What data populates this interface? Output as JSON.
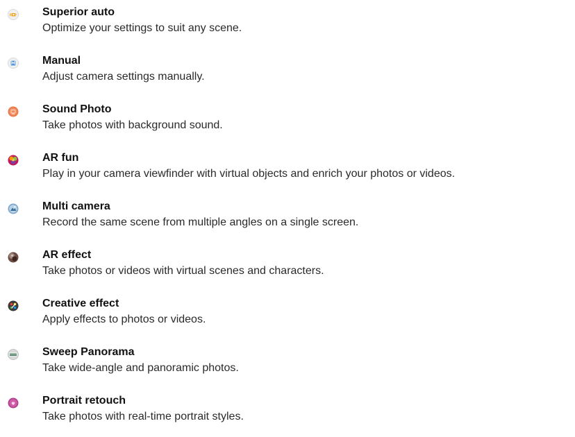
{
  "modes": [
    {
      "title": "Superior auto",
      "description": "Optimize your settings to suit any scene.",
      "icon": "superior-auto-icon"
    },
    {
      "title": "Manual",
      "description": "Adjust camera settings manually.",
      "icon": "manual-m-icon"
    },
    {
      "title": "Sound Photo",
      "description": "Take photos with background sound.",
      "icon": "sound-photo-icon"
    },
    {
      "title": "AR fun",
      "description": "Play in your camera viewfinder with virtual objects and enrich your photos or videos.",
      "icon": "ar-fun-icon"
    },
    {
      "title": "Multi camera",
      "description": "Record the same scene from multiple angles on a single screen.",
      "icon": "multi-camera-icon"
    },
    {
      "title": "AR effect",
      "description": "Take photos or videos with virtual scenes and characters.",
      "icon": "ar-effect-icon"
    },
    {
      "title": "Creative effect",
      "description": "Apply effects to photos or videos.",
      "icon": "creative-effect-icon"
    },
    {
      "title": "Sweep Panorama",
      "description": "Take wide-angle and panoramic photos.",
      "icon": "sweep-panorama-icon"
    },
    {
      "title": "Portrait retouch",
      "description": "Take photos with real-time portrait styles.",
      "icon": "portrait-retouch-icon"
    }
  ]
}
